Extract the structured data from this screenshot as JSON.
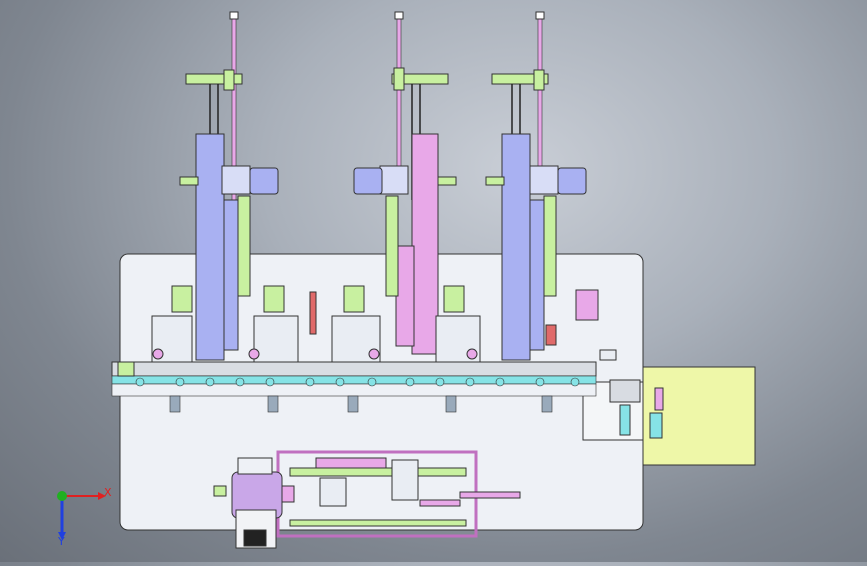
{
  "viewport": {
    "background_top": "#c9ced6",
    "background_bottom": "#6a7079"
  },
  "colors": {
    "base_plate": "#eef1f6",
    "blue_part": "#a9b1f2",
    "pink_part": "#e8a8e8",
    "green_part": "#c8f0a0",
    "cyan_part": "#86e3e6",
    "yellow_panel": "#eef7a8",
    "outline": "#222222",
    "rail": "#d9dde3"
  },
  "triad": {
    "x_label": "X",
    "y_label": "Y",
    "x_color": "#e02020",
    "y_color": "#20b020",
    "z_color": "#2040e0"
  }
}
